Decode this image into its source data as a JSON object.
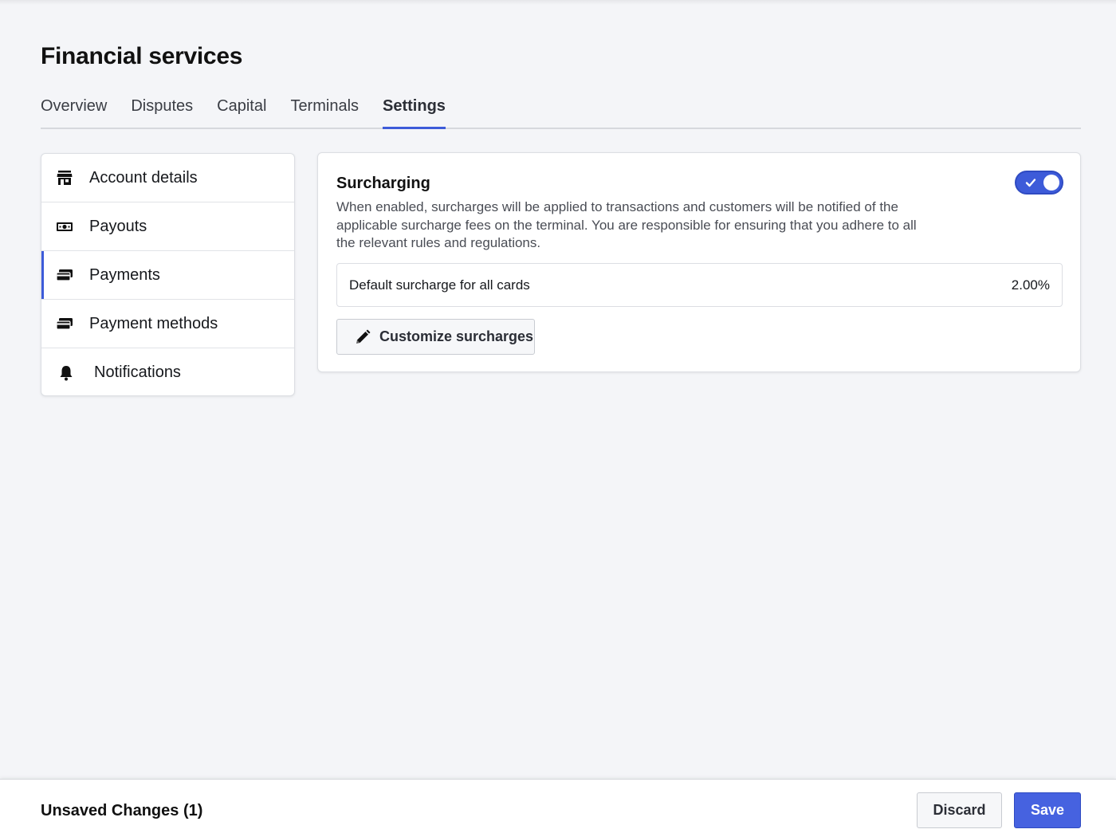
{
  "page": {
    "title": "Financial services"
  },
  "tabs": [
    {
      "label": "Overview",
      "active": false
    },
    {
      "label": "Disputes",
      "active": false
    },
    {
      "label": "Capital",
      "active": false
    },
    {
      "label": "Terminals",
      "active": false
    },
    {
      "label": "Settings",
      "active": true
    }
  ],
  "sidebar": {
    "items": [
      {
        "label": "Account details",
        "icon": "store-icon"
      },
      {
        "label": "Payouts",
        "icon": "cash-icon"
      },
      {
        "label": "Payments",
        "icon": "cards-icon",
        "active": true
      },
      {
        "label": "Payment methods",
        "icon": "cards-icon"
      },
      {
        "label": "Notifications",
        "icon": "bell-icon"
      }
    ]
  },
  "surcharging": {
    "title": "Surcharging",
    "description": "When enabled, surcharges will be applied to transactions and customers will be notified of the applicable surcharge fees on the terminal. You are responsible for ensuring that you adhere to all the relevant rules and regulations.",
    "enabled": true,
    "default_rate_label": "Default surcharge for all cards",
    "default_rate_value": "2.00%",
    "customize_label": "Customize surcharges"
  },
  "footer": {
    "unsaved_label": "Unsaved Changes (1)",
    "discard_label": "Discard",
    "save_label": "Save"
  },
  "colors": {
    "accent": "#3d5bd9",
    "save_button": "#4662e0",
    "background": "#f4f5f8"
  }
}
